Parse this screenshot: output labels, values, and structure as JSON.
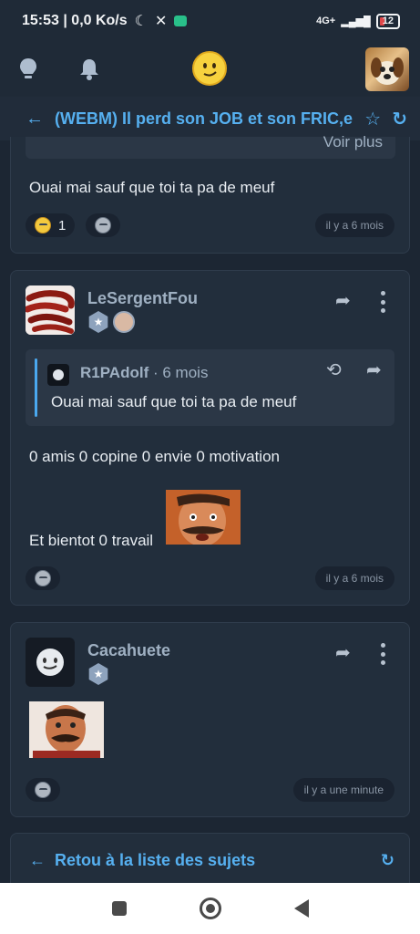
{
  "status_bar": {
    "left_text": "15:53 | 0,0 Ko/s",
    "network": "4G+",
    "battery": "12"
  },
  "topic": {
    "title": "(WEBM) Il perd son JOB et son FRIC,ell"
  },
  "post1": {
    "voir_plus": "Voir plus",
    "text": "Ouai mai sauf que toi ta pa de meuf",
    "reaction_count": "1",
    "time": "il y a 6 mois"
  },
  "post2": {
    "username": "LeSergentFou",
    "quote_user": "R1PAdolf",
    "quote_time": "· 6 mois",
    "quote_text": "Ouai mai sauf que toi ta pa de meuf",
    "line1": "0 amis 0 copine 0 envie 0 motivation",
    "line2": "Et bientot 0 travail",
    "time": "il y a 6 mois"
  },
  "post3": {
    "username": "Cacahuete",
    "time": "il y a une minute"
  },
  "footer": {
    "back_label": "Retou à la liste des sujets"
  }
}
